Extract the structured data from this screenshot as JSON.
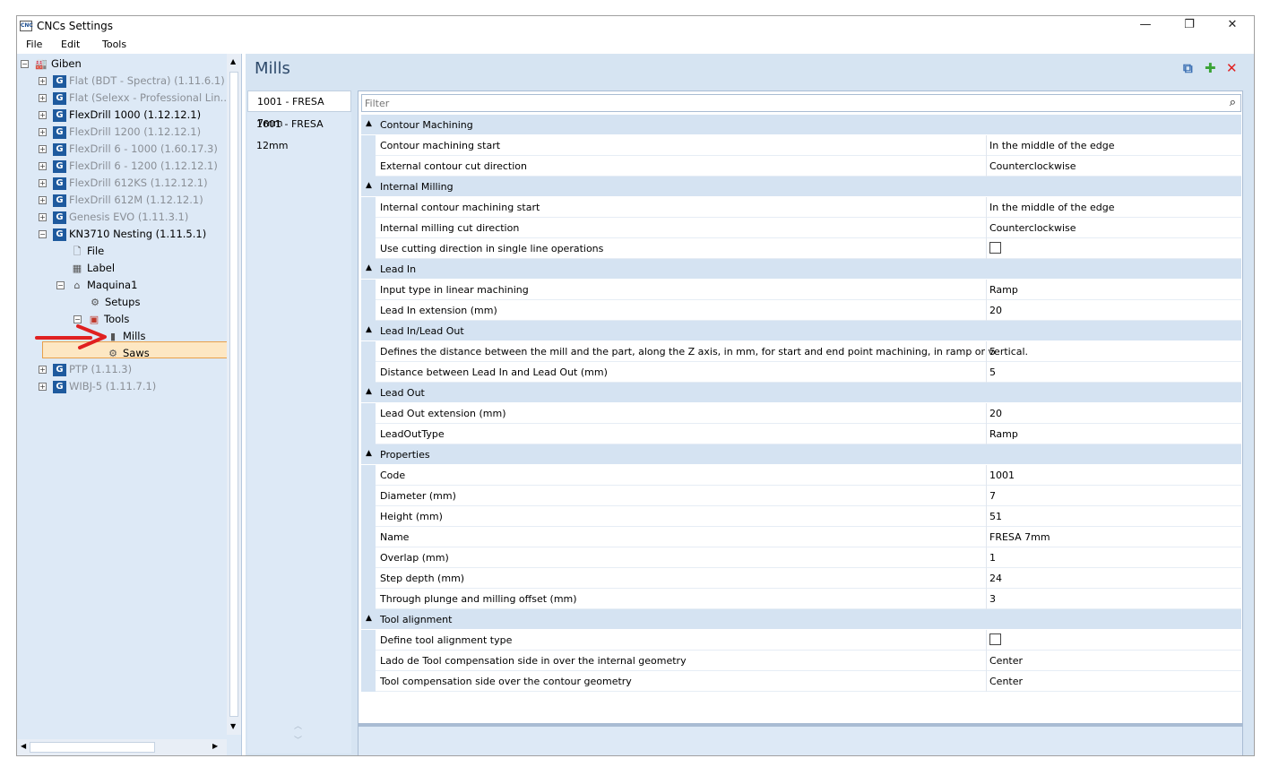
{
  "window": {
    "title": "CNCs Settings",
    "app_icon_text": "CNC",
    "controls": {
      "minimize": "—",
      "restore": "❐",
      "close": "✕"
    }
  },
  "menu": [
    "File",
    "Edit",
    "Tools"
  ],
  "tree": {
    "root": "Giben",
    "machines": [
      {
        "label": "Flat (BDT - Spectra) (1.11.6.1)",
        "enabled": false
      },
      {
        "label": "Flat (Selexx - Professional Lin...",
        "enabled": false
      },
      {
        "label": "FlexDrill 1000 (1.12.12.1)",
        "enabled": true
      },
      {
        "label": "FlexDrill 1200 (1.12.12.1)",
        "enabled": false
      },
      {
        "label": "FlexDrill 6 - 1000 (1.60.17.3)",
        "enabled": false
      },
      {
        "label": "FlexDrill 6 - 1200 (1.12.12.1)",
        "enabled": false
      },
      {
        "label": "FlexDrill 612KS (1.12.12.1)",
        "enabled": false
      },
      {
        "label": "FlexDrill 612M (1.12.12.1)",
        "enabled": false
      },
      {
        "label": "Genesis EVO (1.11.3.1)",
        "enabled": false
      },
      {
        "label": "KN3710 Nesting (1.11.5.1)",
        "enabled": true
      }
    ],
    "kn_children": {
      "file": "File",
      "label": "Label",
      "machine": "Maquina1",
      "setups": "Setups",
      "tools": "Tools",
      "mills": "Mills",
      "saws": "Saws"
    },
    "after": [
      {
        "label": "PTP (1.11.3)",
        "enabled": false
      },
      {
        "label": "WIBJ-5 (1.11.7.1)",
        "enabled": false
      }
    ]
  },
  "page": {
    "title": "Mills"
  },
  "mills_list": [
    "1001 - FRESA 7mm",
    "1601 - FRESA 12mm"
  ],
  "filter": {
    "placeholder": "Filter"
  },
  "categories": [
    {
      "name": "Contour Machining",
      "props": [
        {
          "name": "Contour machining start",
          "value": "In the middle of the edge"
        },
        {
          "name": "External contour cut direction",
          "value": "Counterclockwise"
        }
      ]
    },
    {
      "name": "Internal Milling",
      "props": [
        {
          "name": "Internal contour machining start",
          "value": "In the middle of the edge"
        },
        {
          "name": "Internal milling cut direction",
          "value": "Counterclockwise"
        },
        {
          "name": "Use cutting direction in single line operations",
          "value": "",
          "checkbox": true
        }
      ]
    },
    {
      "name": "Lead In",
      "props": [
        {
          "name": "Input type in linear machining",
          "value": "Ramp"
        },
        {
          "name": "Lead In extension (mm)",
          "value": "20"
        }
      ]
    },
    {
      "name": "Lead In/Lead Out",
      "props": [
        {
          "name": "Defines the distance between the mill and the part, along the Z axis, in mm, for start and end point machining, in ramp or vertical.",
          "value": "5"
        },
        {
          "name": "Distance between Lead In and Lead Out (mm)",
          "value": "5"
        }
      ]
    },
    {
      "name": "Lead Out",
      "props": [
        {
          "name": "Lead Out extension (mm)",
          "value": "20"
        },
        {
          "name": "LeadOutType",
          "value": "Ramp"
        }
      ]
    },
    {
      "name": "Properties",
      "props": [
        {
          "name": "Code",
          "value": "1001"
        },
        {
          "name": "Diameter (mm)",
          "value": "7"
        },
        {
          "name": "Height (mm)",
          "value": "51"
        },
        {
          "name": "Name",
          "value": "FRESA 7mm"
        },
        {
          "name": "Overlap (mm)",
          "value": "1"
        },
        {
          "name": "Step depth (mm)",
          "value": "24"
        },
        {
          "name": "Through plunge and milling offset (mm)",
          "value": "3"
        }
      ]
    },
    {
      "name": "Tool alignment",
      "props": [
        {
          "name": "Define tool alignment type",
          "value": "",
          "checkbox": true
        },
        {
          "name": "Lado de Tool compensation side in over the internal geometry",
          "value": "Center"
        },
        {
          "name": "Tool compensation side over the contour geometry",
          "value": "Center"
        }
      ]
    }
  ],
  "colors": {
    "accent": "#1e5a9e",
    "selection": "#fde7c3",
    "arrow": "#e02020",
    "add": "#3aa335",
    "delete": "#e02020"
  }
}
